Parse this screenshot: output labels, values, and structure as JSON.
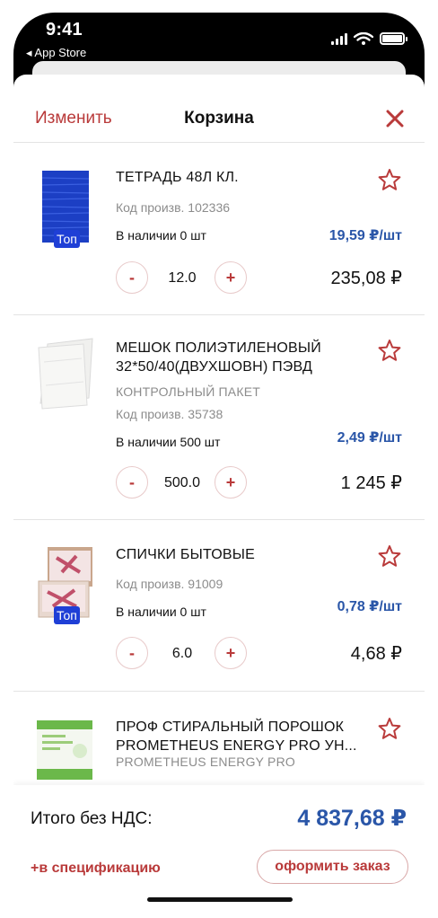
{
  "status_bar": {
    "time": "9:41",
    "back_app": "◂ App Store"
  },
  "nav": {
    "edit": "Изменить",
    "title": "Корзина"
  },
  "items": [
    {
      "name": "ТЕТРАДЬ 48Л КЛ.",
      "brand": "",
      "code": "Код произв. 102336",
      "stock": "В наличии 0 шт",
      "unit_price": "19,59 ₽/шт",
      "qty": "12.0",
      "total": "235,08 ₽",
      "badge": "Топ"
    },
    {
      "name": "МЕШОК ПОЛИЭТИЛЕНОВЫЙ 32*50/40(ДВУХШОВН) ПЭВД",
      "brand": "КОНТРОЛЬНЫЙ ПАКЕТ",
      "code": "Код произв. 35738",
      "stock": "В наличии 500 шт",
      "unit_price": "2,49 ₽/шт",
      "qty": "500.0",
      "total": "1 245 ₽",
      "badge": ""
    },
    {
      "name": "СПИЧКИ БЫТОВЫЕ",
      "brand": "",
      "code": "Код произв. 91009",
      "stock": "В наличии 0 шт",
      "unit_price": "0,78 ₽/шт",
      "qty": "6.0",
      "total": "4,68 ₽",
      "badge": "Топ"
    },
    {
      "name": "ПРОФ СТИРАЛЬНЫЙ ПОРОШОК PROMETHEUS ENERGY PRO УН...",
      "brand": "PROMETHEUS ENERGY PRO",
      "code": "",
      "stock": "",
      "unit_price": "",
      "qty": "",
      "total": "",
      "badge": ""
    }
  ],
  "controls": {
    "minus": "-",
    "plus": "+"
  },
  "footer": {
    "label": "Итого без НДС:",
    "sum": "4 837,68 ₽",
    "spec_link": "+в спецификацию",
    "order_button": "оформить заказ"
  },
  "colors": {
    "accent": "#b93a3a",
    "price": "#2a56a8",
    "badge": "#1f3fd6"
  },
  "icons": {
    "close": "close-icon",
    "star": "star-outline-icon"
  }
}
